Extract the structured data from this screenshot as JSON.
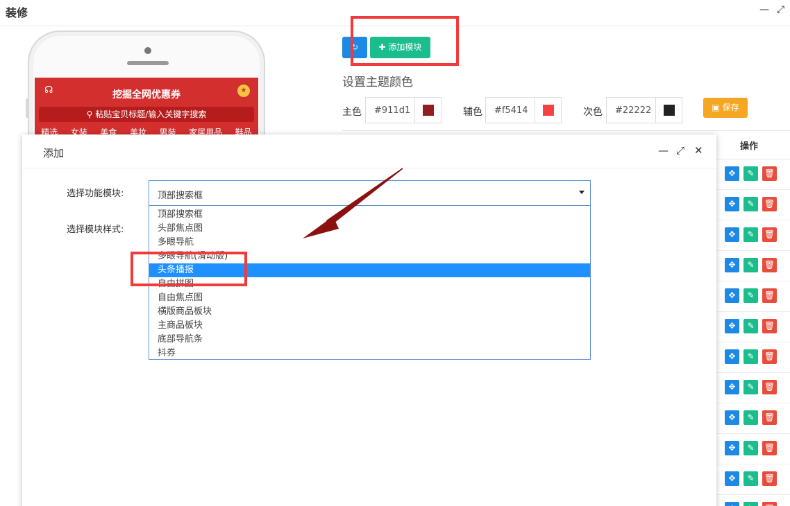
{
  "window": {
    "title": "装修"
  },
  "phone": {
    "header_title": "挖掘全网优惠券",
    "search_placeholder": "粘贴宝贝标题/输入关键字搜索",
    "categories": [
      "精选",
      "女装",
      "美食",
      "美妆",
      "男装",
      "家居用品",
      "鞋品"
    ]
  },
  "toolbar": {
    "add_module_label": "添加模块"
  },
  "theme": {
    "title": "设置主题颜色",
    "primary_label": "主色",
    "primary_value": "#911d1",
    "primary_color": "#911d1d",
    "secondary_label": "辅色",
    "secondary_value": "#f5414",
    "secondary_color": "#f54141",
    "tertiary_label": "次色",
    "tertiary_value": "#22222",
    "tertiary_color": "#222222",
    "save_label": "保存"
  },
  "table": {
    "op_header": "操作"
  },
  "dialog": {
    "title": "添加",
    "module_label": "选择功能模块:",
    "style_label": "选择模块样式:",
    "selected_value": "顶部搜索框",
    "options": [
      "顶部搜索框",
      "头部焦点图",
      "多眼导航",
      "多眼导航(滑动版)",
      "头条播报",
      "自由拼图",
      "自由焦点图",
      "横版商品板块",
      "主商品板块",
      "底部导航条",
      "抖券"
    ],
    "highlighted_index": 4
  },
  "colors": {
    "accent_blue": "#1e88e5",
    "accent_green": "#1bbd8c",
    "accent_red": "#e74c3c",
    "save_orange": "#f5a623",
    "annotation_red": "#ef3b3b"
  }
}
